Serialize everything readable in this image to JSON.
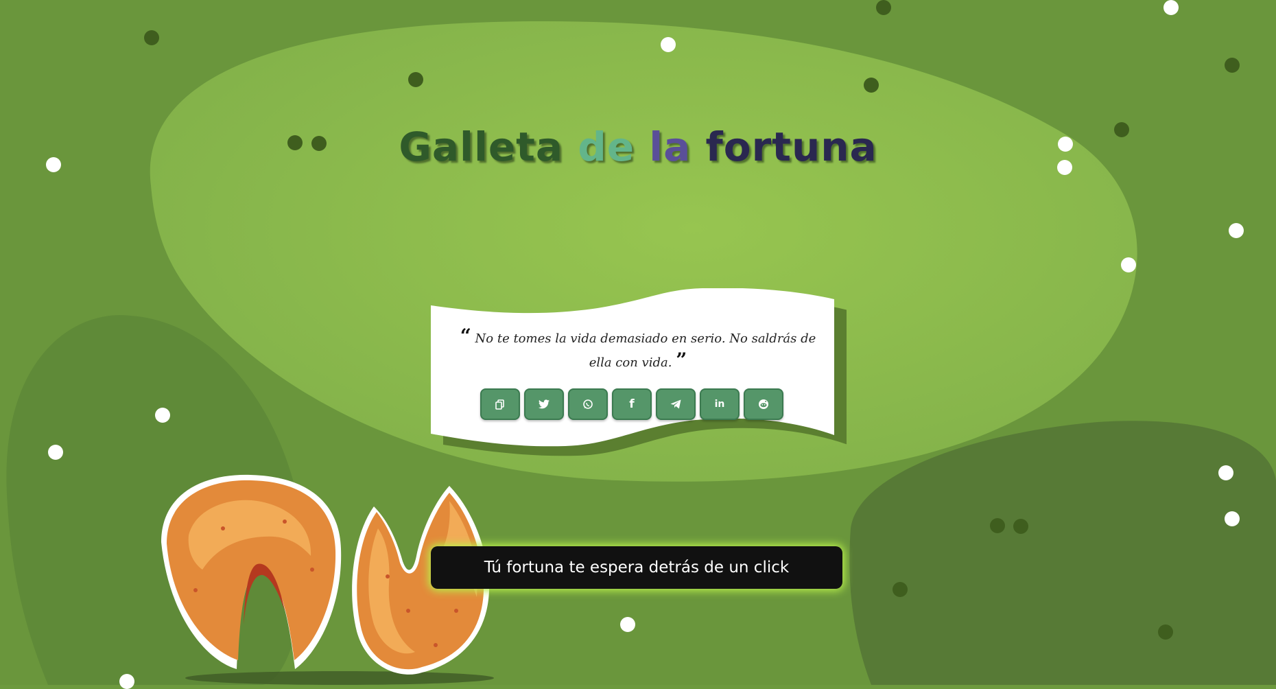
{
  "title": {
    "words": [
      {
        "text": "Galleta",
        "color": "#2f5a2a"
      },
      {
        "text": "de",
        "color": "#63b58a"
      },
      {
        "text": "la",
        "color": "#5a4f99"
      },
      {
        "text": "fortuna",
        "color": "#3a3470"
      }
    ]
  },
  "quote": {
    "open_mark": "“",
    "text": "No te tomes la vida demasiado en serio. No saldrás de ella con vida.",
    "close_mark": "”"
  },
  "share_buttons": [
    {
      "icon": "copy-icon",
      "glyph": "⧉"
    },
    {
      "icon": "twitter-icon",
      "glyph": "🐦"
    },
    {
      "icon": "whatsapp-icon",
      "glyph": "✆"
    },
    {
      "icon": "facebook-icon",
      "glyph": "f"
    },
    {
      "icon": "telegram-icon",
      "glyph": "➤"
    },
    {
      "icon": "linkedin-icon",
      "glyph": "in"
    },
    {
      "icon": "reddit-icon",
      "glyph": "◉"
    }
  ],
  "cta": {
    "label": "Tú fortuna te espera detrás de un click"
  },
  "colors": {
    "background": "#6d9a3e",
    "blob_light": "#8fbb4e",
    "blob_dark": "#5b7f37",
    "button_green": "#559669",
    "cta_glow": "#b8f04a"
  }
}
